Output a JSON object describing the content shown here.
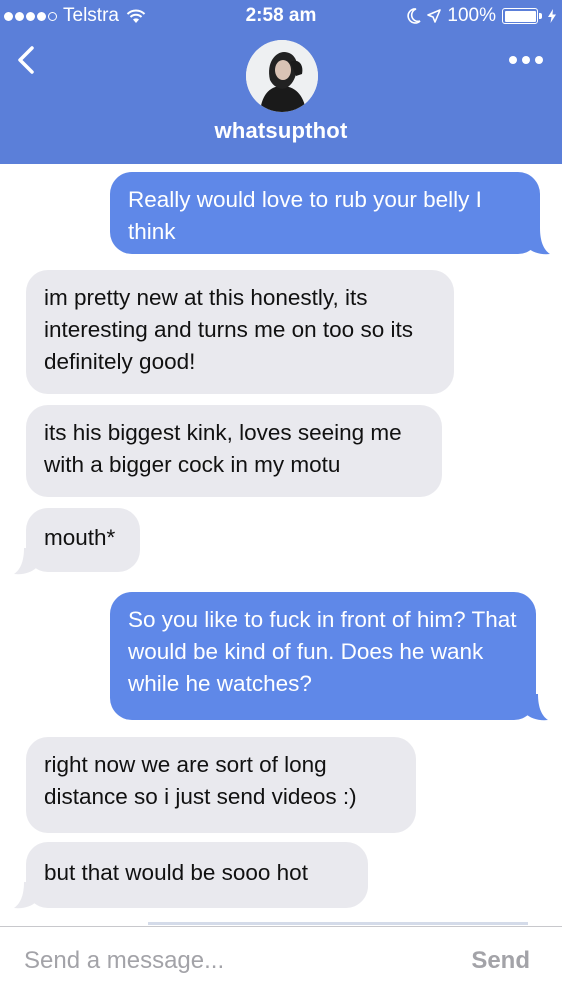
{
  "status_bar": {
    "carrier": "Telstra",
    "time": "2:58 am",
    "battery": "100%",
    "signal_icon": "signal-dots-icon",
    "wifi_icon": "wifi-icon"
  },
  "header": {
    "contact_name": "whatsupthot",
    "back_icon": "chevron-left-icon",
    "more_icon": "ellipsis-icon",
    "background_color": "#5b7fd9"
  },
  "messages": [
    {
      "direction": "out",
      "text": "Really would love to rub your belly I think"
    },
    {
      "direction": "in",
      "text": "im pretty new at this honestly, its interesting and turns me on too so its definitely good!"
    },
    {
      "direction": "in",
      "text": "its his biggest kink, loves seeing me with a bigger cock in my motu"
    },
    {
      "direction": "in",
      "text": "mouth*"
    },
    {
      "direction": "out",
      "text": "So you like to fuck in front of him? That would be kind of fun. Does he wank while he watches?"
    },
    {
      "direction": "in",
      "text": "right now we are sort of long distance so i just send videos :)"
    },
    {
      "direction": "in",
      "text": "but that would be sooo hot"
    }
  ],
  "compose": {
    "placeholder": "Send a message...",
    "send_label": "Send"
  },
  "colors": {
    "outgoing_bubble": "#5f88e8",
    "incoming_bubble": "#e9e9ee"
  }
}
